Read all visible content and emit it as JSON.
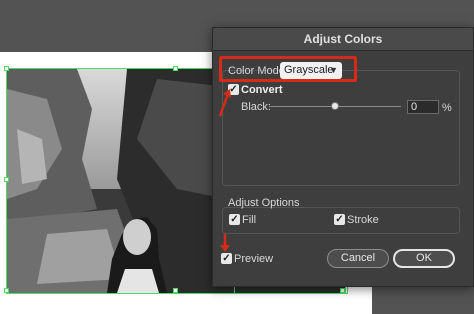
{
  "dialog": {
    "title": "Adjust Colors",
    "color_mode_label": "Color Mode:",
    "color_mode_value": "Grayscale",
    "convert_label": "Convert",
    "convert_checked": true,
    "black_label": "Black:",
    "black_value": "0",
    "black_unit": "%",
    "black_slider_level": 0.5,
    "adjust_options_label": "Adjust Options",
    "fill_label": "Fill",
    "fill_checked": true,
    "stroke_label": "Stroke",
    "stroke_checked": true,
    "preview_label": "Preview",
    "preview_checked": true,
    "cancel_label": "Cancel",
    "ok_label": "OK"
  },
  "colors": {
    "selection": "#4cd964",
    "highlight": "#d72b1a",
    "dialog_bg": "#3e3e3e"
  },
  "icons": {
    "checkmark": "checkmark-icon",
    "dropdown": "chevron-down-icon",
    "annotation": "red-arrow-icon"
  }
}
